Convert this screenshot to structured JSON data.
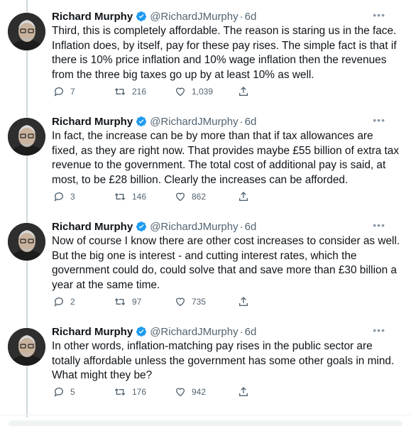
{
  "tweets": [
    {
      "name": "Richard Murphy",
      "handle": "@RichardJMurphy",
      "time": "6d",
      "text": "Third, this is completely affordable. The reason is staring us in the face. Inflation does, by itself, pay for these pay rises. The simple fact is that if there is 10% price inflation and 10% wage inflation then the revenues from the three big taxes go up by at least 10% as well.",
      "replies": "7",
      "retweets": "216",
      "likes": "1,039"
    },
    {
      "name": "Richard Murphy",
      "handle": "@RichardJMurphy",
      "time": "6d",
      "text": "In fact, the increase can be by more than that if tax allowances are fixed, as they are right now. That provides maybe £55 billion of extra tax revenue to the government. The total cost of additional pay is said, at most, to be £28 billion. Clearly the increases can be afforded.",
      "replies": "3",
      "retweets": "146",
      "likes": "862"
    },
    {
      "name": "Richard Murphy",
      "handle": "@RichardJMurphy",
      "time": "6d",
      "text": "Now of course I know there are other cost increases to consider as well. But the big one is interest - and cutting interest rates, which the government could do, could solve that and save more than £30 billion a year at the same time.",
      "replies": "2",
      "retweets": "97",
      "likes": "735"
    },
    {
      "name": "Richard Murphy",
      "handle": "@RichardJMurphy",
      "time": "6d",
      "text": "In other words, inflation-matching pay rises in the public sector are totally affordable unless the government has some other goals in mind. What might they be?",
      "replies": "5",
      "retweets": "176",
      "likes": "942"
    }
  ],
  "colors": {
    "verified": "#1d9bf0",
    "secondary_text": "#536471",
    "thread_line": "#cfd9de"
  },
  "icons": {
    "reply": "reply-icon",
    "retweet": "retweet-icon",
    "like": "heart-icon",
    "share": "share-icon",
    "more": "more-icon",
    "verified": "verified-badge-icon"
  }
}
